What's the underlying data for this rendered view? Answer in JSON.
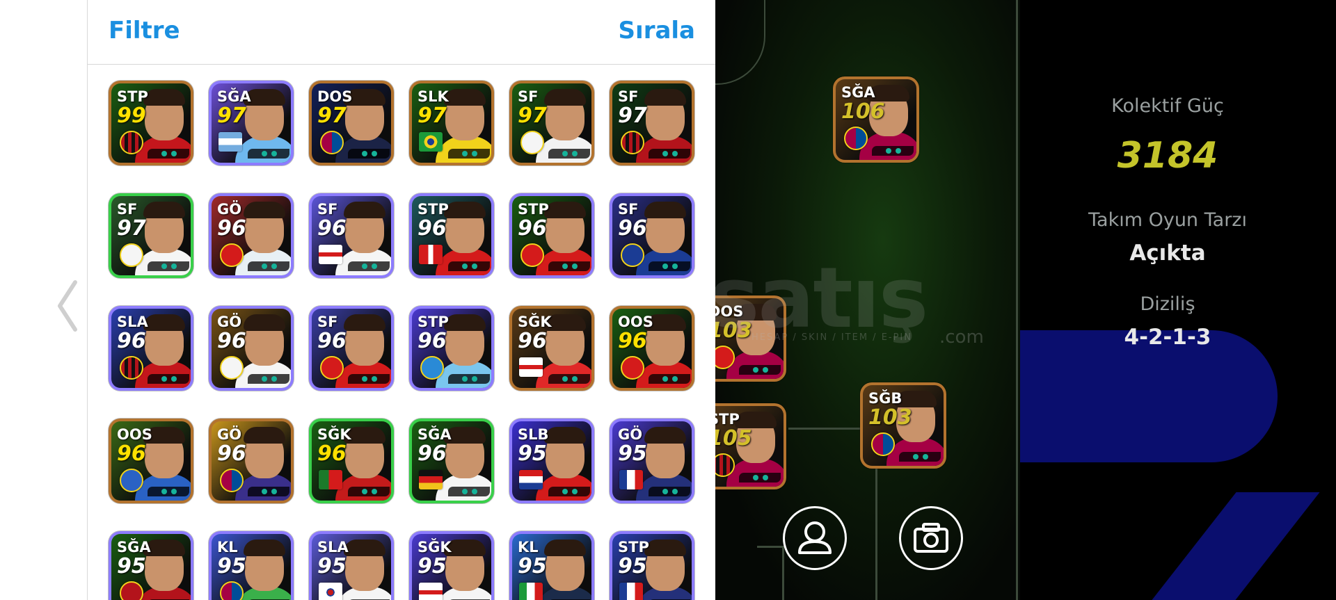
{
  "panel": {
    "filter_label": "Filtre",
    "sort_label": "Sırala"
  },
  "players": [
    {
      "pos": "STP",
      "rating": "99",
      "rating_color": "#ffe100",
      "border": "#b3732e",
      "bg": "#1a5f12",
      "shirt": "#c4161c",
      "club": "ac-milan-badge"
    },
    {
      "pos": "SĞA",
      "rating": "97",
      "rating_color": "#ffe100",
      "border": "#8d7cff",
      "bg": "#6c4fd6",
      "shirt": "#6fb8ee",
      "club": "argentina-flag"
    },
    {
      "pos": "DOS",
      "rating": "97",
      "rating_color": "#ffe100",
      "border": "#b3732e",
      "bg": "#12205a",
      "shirt": "#1b2346",
      "club": "barcelona-badge"
    },
    {
      "pos": "SLK",
      "rating": "97",
      "rating_color": "#ffe100",
      "border": "#b3732e",
      "bg": "#1a5f12",
      "shirt": "#f1d21b",
      "club": "brazil-flag"
    },
    {
      "pos": "SF",
      "rating": "97",
      "rating_color": "#ffe100",
      "border": "#b3732e",
      "bg": "#1a5f12",
      "shirt": "#f2f2f2",
      "club": "santos-badge"
    },
    {
      "pos": "SF",
      "rating": "97",
      "rating_color": "#ffffff",
      "border": "#b3732e",
      "bg": "#0f3d14",
      "shirt": "#b3131b",
      "club": "ac-milan-badge"
    },
    {
      "pos": "SF",
      "rating": "97",
      "rating_color": "#ffffff",
      "border": "#39d04a",
      "bg": "#2a5a2a",
      "shirt": "#f5f5f5",
      "club": "real-madrid-badge"
    },
    {
      "pos": "GÖ",
      "rating": "96",
      "rating_color": "#ffffff",
      "border": "#8d7cff",
      "bg": "#a12a2a",
      "shirt": "#e8f0f5",
      "club": "arsenal-badge"
    },
    {
      "pos": "SF",
      "rating": "96",
      "rating_color": "#ffffff",
      "border": "#8d7cff",
      "bg": "#5b55d8",
      "shirt": "#f5f5f5",
      "club": "england-flag"
    },
    {
      "pos": "STP",
      "rating": "96",
      "rating_color": "#ffffff",
      "border": "#8d7cff",
      "bg": "#1e5a5e",
      "shirt": "#d41b1b",
      "club": "switzerland-flag"
    },
    {
      "pos": "STP",
      "rating": "96",
      "rating_color": "#ffffff",
      "border": "#8d7cff",
      "bg": "#1a5f12",
      "shirt": "#d41b1b",
      "club": "arsenal-badge"
    },
    {
      "pos": "SF",
      "rating": "96",
      "rating_color": "#ffffff",
      "border": "#8d7cff",
      "bg": "#2b2f8a",
      "shirt": "#1b3c94",
      "club": "inter-badge"
    },
    {
      "pos": "SLA",
      "rating": "96",
      "rating_color": "#ffffff",
      "border": "#8d7cff",
      "bg": "#2a3fb0",
      "shirt": "#c4161c",
      "club": "ac-milan-badge"
    },
    {
      "pos": "GÖ",
      "rating": "96",
      "rating_color": "#ffffff",
      "border": "#8d7cff",
      "bg": "#7a5416",
      "shirt": "#f5f5f5",
      "club": "real-madrid-badge"
    },
    {
      "pos": "SF",
      "rating": "96",
      "rating_color": "#ffffff",
      "border": "#8d7cff",
      "bg": "#3b3fa8",
      "shirt": "#d41b1b",
      "club": "lille-badge"
    },
    {
      "pos": "STP",
      "rating": "96",
      "rating_color": "#ffffff",
      "border": "#8d7cff",
      "bg": "#4a3ad0",
      "shirt": "#7ac6ee",
      "club": "napoli-badge"
    },
    {
      "pos": "SĞK",
      "rating": "96",
      "rating_color": "#ffffff",
      "border": "#b3732e",
      "bg": "#5a3b16",
      "shirt": "#e02828",
      "club": "england-flag"
    },
    {
      "pos": "OOS",
      "rating": "96",
      "rating_color": "#ffe100",
      "border": "#b3732e",
      "bg": "#1a5f12",
      "shirt": "#d41b1b",
      "club": "arsenal-badge"
    },
    {
      "pos": "OOS",
      "rating": "96",
      "rating_color": "#ffe100",
      "border": "#b3732e",
      "bg": "#3a6a16",
      "shirt": "#2a62c4",
      "club": "kawasaki-badge"
    },
    {
      "pos": "GÖ",
      "rating": "96",
      "rating_color": "#ffffff",
      "border": "#b3732e",
      "bg": "#c8951c",
      "shirt": "#3a2f8a",
      "club": "barcelona-badge"
    },
    {
      "pos": "SĞK",
      "rating": "96",
      "rating_color": "#ffe100",
      "border": "#39d04a",
      "bg": "#1a5f12",
      "shirt": "#c41b1b",
      "club": "portugal-flag"
    },
    {
      "pos": "SĞA",
      "rating": "96",
      "rating_color": "#ffffff",
      "border": "#39d04a",
      "bg": "#1a5f12",
      "shirt": "#f5f5f5",
      "club": "germany-flag"
    },
    {
      "pos": "SLB",
      "rating": "95",
      "rating_color": "#ffffff",
      "border": "#8d7cff",
      "bg": "#3b2fd0",
      "shirt": "#d41b1b",
      "club": "croatia-flag"
    },
    {
      "pos": "GÖ",
      "rating": "95",
      "rating_color": "#ffffff",
      "border": "#8d7cff",
      "bg": "#4a3ad0",
      "shirt": "#24307a",
      "club": "france-flag"
    },
    {
      "pos": "SĞA",
      "rating": "95",
      "rating_color": "#ffffff",
      "border": "#8d7cff",
      "bg": "#1a5f12",
      "shirt": "#b3131b",
      "club": "roma-badge"
    },
    {
      "pos": "KL",
      "rating": "95",
      "rating_color": "#ffffff",
      "border": "#8d7cff",
      "bg": "#3b55d0",
      "shirt": "#3ab04a",
      "club": "barcelona-badge"
    },
    {
      "pos": "SLA",
      "rating": "95",
      "rating_color": "#ffffff",
      "border": "#8d7cff",
      "bg": "#5b5bd8",
      "shirt": "#f5f5f5",
      "club": "korea-flag"
    },
    {
      "pos": "SĞK",
      "rating": "95",
      "rating_color": "#ffffff",
      "border": "#8d7cff",
      "bg": "#4a3ad0",
      "shirt": "#f5f5f5",
      "club": "england-flag"
    },
    {
      "pos": "KL",
      "rating": "95",
      "rating_color": "#ffffff",
      "border": "#8d7cff",
      "bg": "#2a6ad0",
      "shirt": "#1b2b4a",
      "club": "italy-flag"
    },
    {
      "pos": "STP",
      "rating": "95",
      "rating_color": "#ffffff",
      "border": "#8d7cff",
      "bg": "#2a3fb0",
      "shirt": "#24307a",
      "club": "france-flag"
    }
  ],
  "field_players": [
    {
      "pos": "SĞA",
      "rating": "106",
      "club": "barcelona-badge"
    },
    {
      "pos": "DOS",
      "rating": "103",
      "club": "arsenal-badge"
    },
    {
      "pos": "STP",
      "rating": "105",
      "club": "ac-milan-badge"
    },
    {
      "pos": "SĞB",
      "rating": "103",
      "club": "barcelona-badge"
    }
  ],
  "field_buttons": {
    "profile_icon": "person-icon",
    "camera_icon": "camera-icon"
  },
  "watermark": {
    "brand": "satış",
    "sub": "HESAP / SKIN / ITEM / E-PIN",
    "tld": ".com"
  },
  "stats": {
    "power_label": "Kolektif Güç",
    "power_value": "3184",
    "style_label": "Takım Oyun Tarzı",
    "style_value": "Açıkta",
    "formation_label": "Diziliş",
    "formation_value": "4-2-1-3"
  }
}
